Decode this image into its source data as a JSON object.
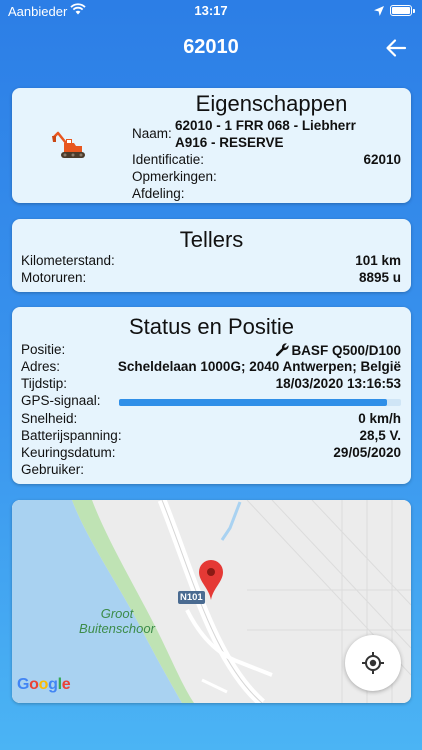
{
  "status_bar": {
    "carrier": "Aanbieder",
    "time": "13:17"
  },
  "navbar": {
    "title": "62010",
    "back_icon": "arrow-left-icon"
  },
  "properties": {
    "title": "Eigenschappen",
    "machine_icon": "excavator-icon",
    "name_label": "Naam:",
    "name_value_line1": "62010 - 1 FRR 068 - Liebherr",
    "name_value_line2": "A916 - RESERVE",
    "id_label": "Identificatie:",
    "id_value": "62010",
    "remarks_label": "Opmerkingen:",
    "department_label": "Afdeling:"
  },
  "counters": {
    "title": "Tellers",
    "odometer_label": "Kilometerstand:",
    "odometer_value": "101 km",
    "hours_label": "Motoruren:",
    "hours_value": "8895 u"
  },
  "status": {
    "title": "Status en Positie",
    "position_label": "Positie:",
    "position_value": "BASF Q500/D100",
    "position_icon": "wrench-icon",
    "address_label": "Adres:",
    "address_value": "Scheldelaan 1000G; 2040 Antwerpen; België",
    "time_label": "Tijdstip:",
    "time_value": "18/03/2020 13:16:53",
    "gps_label": "GPS-signaal:",
    "gps_level": 0.95,
    "speed_label": "Snelheid:",
    "speed_value": "0 km/h",
    "battery_label": "Batterijspanning:",
    "battery_value": "28,5 V.",
    "inspection_label": "Keuringsdatum:",
    "inspection_value": "29/05/2020",
    "user_label": "Gebruiker:"
  },
  "map": {
    "place_name_line1": "Groot",
    "place_name_line2": "Buitenschoor",
    "road_label": "N101",
    "attribution": "Google",
    "marker_icon": "map-pin-icon",
    "locate_icon": "crosshair-icon"
  },
  "colors": {
    "accent": "#2f8fe8",
    "card_background": "#e6f4fd",
    "marker": "#e53935"
  }
}
